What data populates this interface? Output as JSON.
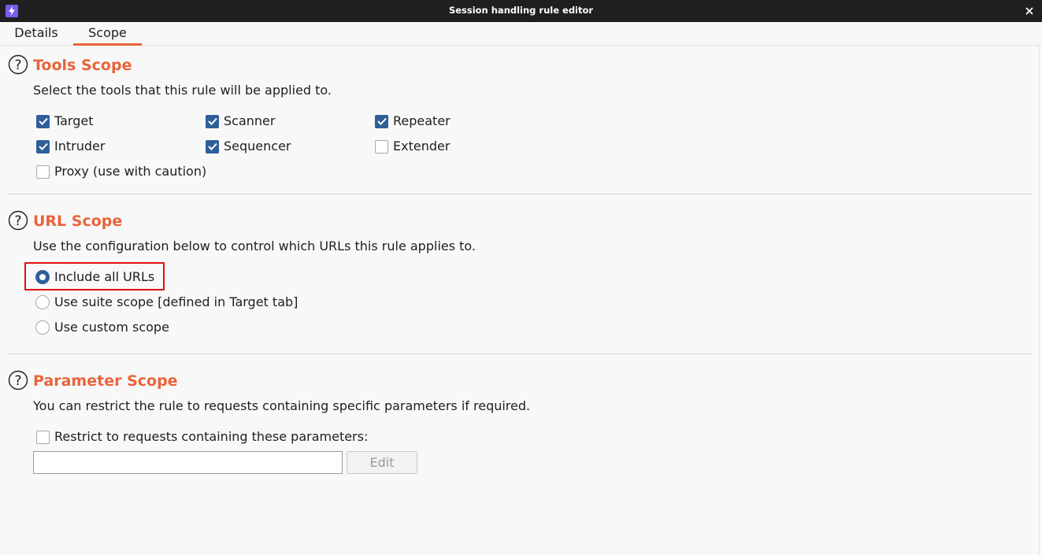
{
  "window": {
    "title": "Session handling rule editor",
    "app_icon": "lightning-bolt-icon",
    "close_icon": "close-icon"
  },
  "tabs": [
    {
      "label": "Details",
      "active": false
    },
    {
      "label": "Scope",
      "active": true
    }
  ],
  "tools_scope": {
    "title": "Tools Scope",
    "description": "Select the tools that this rule will be applied to.",
    "tools": [
      {
        "label": "Target",
        "checked": true
      },
      {
        "label": "Scanner",
        "checked": true
      },
      {
        "label": "Repeater",
        "checked": true
      },
      {
        "label": "Intruder",
        "checked": true
      },
      {
        "label": "Sequencer",
        "checked": true
      },
      {
        "label": "Extender",
        "checked": false
      },
      {
        "label": "Proxy (use with caution)",
        "checked": false
      }
    ]
  },
  "url_scope": {
    "title": "URL Scope",
    "description": "Use the configuration below to control which URLs this rule applies to.",
    "options": [
      {
        "label": "Include all URLs",
        "selected": true
      },
      {
        "label": "Use suite scope [defined in Target tab]",
        "selected": false
      },
      {
        "label": "Use custom scope",
        "selected": false
      }
    ]
  },
  "parameter_scope": {
    "title": "Parameter Scope",
    "description": "You can restrict the rule to requests containing specific parameters if required.",
    "restrict_label": "Restrict to requests containing these parameters:",
    "restrict_checked": false,
    "parameters_value": "",
    "edit_label": "Edit"
  },
  "colors": {
    "accent": "#e8643a",
    "checkbox": "#2f5f99",
    "highlight": "#e01010",
    "titlebar": "#1f1f1f"
  }
}
